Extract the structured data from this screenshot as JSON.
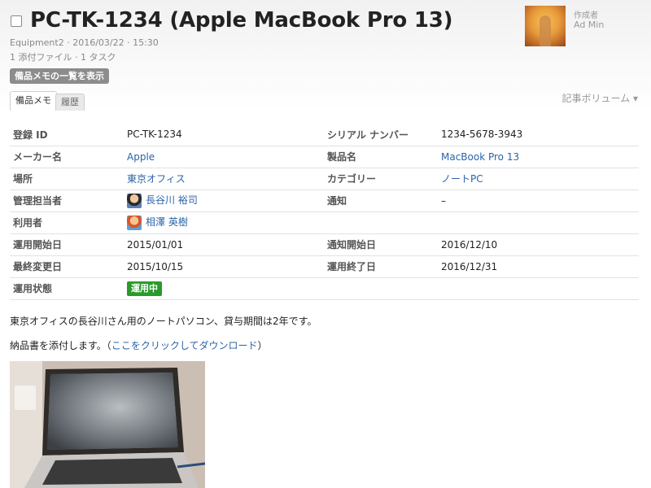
{
  "header": {
    "title": "PC-TK-1234 (Apple MacBook Pro 13)",
    "meta_line1": "Equipment2 · 2016/03/22 · 15:30",
    "meta_line2": "1 添付ファイル · 1 タスク",
    "memo_list_button": "備品メモの一覧を表示",
    "author_label": "作成者",
    "author_name": "Ad Min"
  },
  "tabs": [
    "備品メモ",
    "履歴"
  ],
  "volume_label": "記事ボリューム ▾",
  "properties": [
    {
      "label1": "登録 ID",
      "value1": "PC-TK-1234",
      "label2": "シリアル ナンバー",
      "value2": "1234-5678-3943"
    },
    {
      "label1": "メーカー名",
      "value1": "Apple",
      "label2": "製品名",
      "value2": "MacBook Pro 13"
    },
    {
      "label1": "場所",
      "value1": "東京オフィス",
      "label2": "カテゴリー",
      "value2": "ノートPC"
    },
    {
      "label1": "管理担当者",
      "value1": "長谷川 裕司",
      "label2": "通知",
      "value2": "–"
    },
    {
      "label1": "利用者",
      "value1": "相澤 英樹",
      "label2": "",
      "value2": ""
    },
    {
      "label1": "運用開始日",
      "value1": "2015/01/01",
      "label2": "通知開始日",
      "value2": "2016/12/10"
    },
    {
      "label1": "最終変更日",
      "value1": "2015/10/15",
      "label2": "運用終了日",
      "value2": "2016/12/31"
    },
    {
      "label1": "運用状態",
      "value1": "運用中",
      "label2": "",
      "value2": ""
    }
  ],
  "status_color": "#2a9a2a",
  "link_color": "#2a64a8",
  "description": {
    "line1": "東京オフィスの長谷川さん用のノートパソコン、貸与期間は2年です。",
    "line2_prefix": "納品書を添付します。（",
    "line2_link": "ここをクリックしてダウンロード",
    "line2_suffix": "）"
  }
}
